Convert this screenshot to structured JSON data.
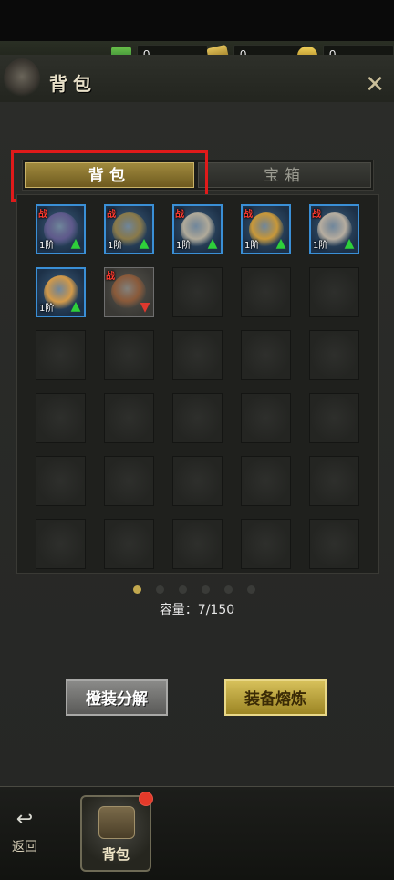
{
  "currencies": [
    {
      "icon": "jade-token-icon",
      "value": "0",
      "color": "#3fae5a"
    },
    {
      "icon": "gold-coupon-icon",
      "value": "0",
      "color": "#c9a43a"
    },
    {
      "icon": "gold-ingot-icon",
      "value": "0",
      "color": "#d8b23a"
    }
  ],
  "header": {
    "title": "背包",
    "close_icon": "close-x-icon"
  },
  "tabs": {
    "active": "背包",
    "inactive": "宝箱"
  },
  "items": [
    {
      "icon": "armor-icon",
      "tag": "战",
      "level": "1阶",
      "arrow": "up",
      "frame": "blue",
      "art_color": "#5f5a8c"
    },
    {
      "icon": "helmet-icon",
      "tag": "战",
      "level": "1阶",
      "arrow": "up",
      "frame": "blue",
      "art_color": "#8a7a4a"
    },
    {
      "icon": "bracelet-icon",
      "tag": "战",
      "level": "1阶",
      "arrow": "up",
      "frame": "blue",
      "art_color": "#b0aa9a"
    },
    {
      "icon": "necklace-icon",
      "tag": "战",
      "level": "1阶",
      "arrow": "up",
      "frame": "blue",
      "art_color": "#c8983a"
    },
    {
      "icon": "ring-icon",
      "tag": "战",
      "level": "1阶",
      "arrow": "up",
      "frame": "blue",
      "art_color": "#b6ada0"
    },
    {
      "icon": "gold-ring-icon",
      "tag": "",
      "level": "1阶",
      "arrow": "up",
      "frame": "blue",
      "art_color": "#d29a4a"
    },
    {
      "icon": "staff-icon",
      "tag": "战",
      "level": "",
      "arrow": "down",
      "frame": "gray",
      "art_color": "#8a5a3a"
    }
  ],
  "grid": {
    "columns": 5,
    "rows": 6
  },
  "pagination": {
    "count": 6,
    "active_index": 0
  },
  "capacity": "容量：7/150",
  "buttons": {
    "decompose": "橙装分解",
    "smelt": "装备熔炼"
  },
  "bottom_nav": {
    "back_label": "返回",
    "bag_label": "背包"
  }
}
